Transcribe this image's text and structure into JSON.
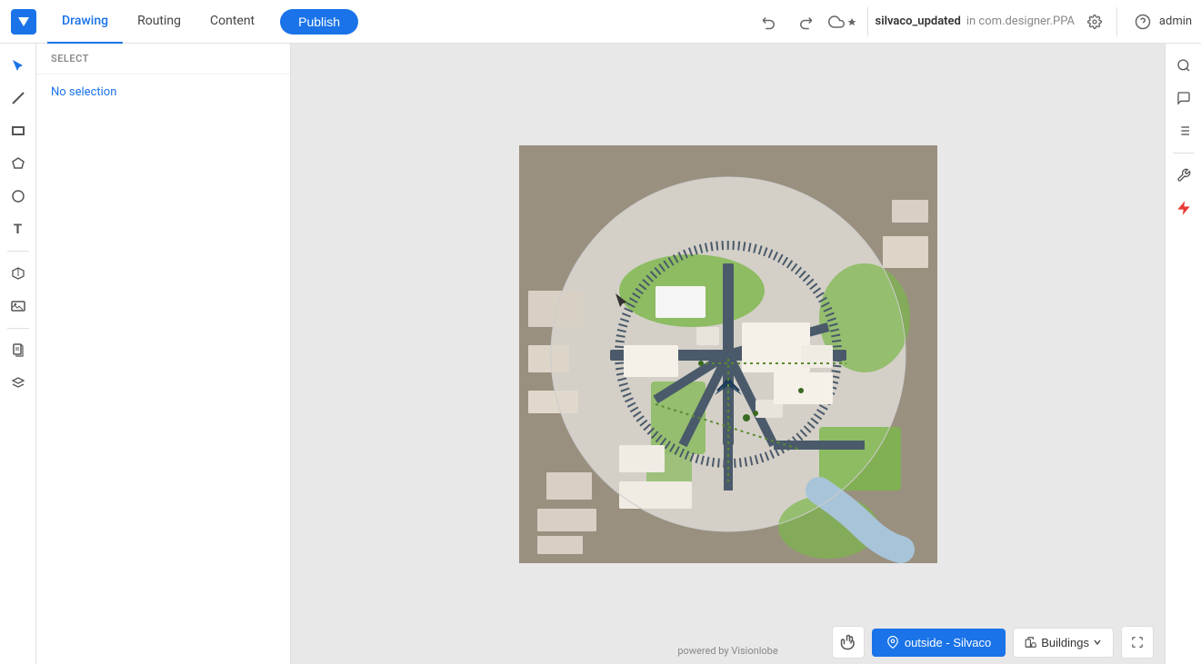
{
  "topbar": {
    "logo_label": "V",
    "tabs": [
      {
        "id": "drawing",
        "label": "Drawing",
        "active": true
      },
      {
        "id": "routing",
        "label": "Routing",
        "active": false
      },
      {
        "id": "content",
        "label": "Content",
        "active": false
      }
    ],
    "publish_label": "Publish",
    "undo_icon": "undo",
    "redo_icon": "redo",
    "cloud_icon": "cloud",
    "project_name": "silvaco_updated",
    "project_path": "in com.designer.PPA",
    "help_icon": "help",
    "user_label": "admin",
    "settings_icon": "settings"
  },
  "left_tools": {
    "tools": [
      {
        "id": "select",
        "icon": "✦",
        "label": "select-tool"
      },
      {
        "id": "line",
        "icon": "↗",
        "label": "line-tool"
      },
      {
        "id": "rectangle",
        "icon": "▭",
        "label": "rectangle-tool"
      },
      {
        "id": "polygon",
        "icon": "⬠",
        "label": "polygon-tool"
      },
      {
        "id": "circle",
        "icon": "○",
        "label": "circle-tool"
      },
      {
        "id": "text",
        "icon": "T",
        "label": "text-tool"
      },
      {
        "id": "box3d",
        "icon": "⬛",
        "label": "3d-box-tool"
      },
      {
        "id": "image",
        "icon": "🏔",
        "label": "image-tool"
      },
      {
        "id": "document",
        "icon": "📄",
        "label": "document-tool"
      },
      {
        "id": "layers",
        "icon": "⊞",
        "label": "layers-tool"
      }
    ]
  },
  "left_panel": {
    "header": "SELECT",
    "no_selection_text": "No selection"
  },
  "canvas": {
    "powered_by": "powered by Visionlobe"
  },
  "bottom_bar": {
    "hand_icon": "✋",
    "location_label": "outside - Silvaco",
    "buildings_label": "Buildings",
    "fullscreen_icon": "⛶"
  },
  "right_panel": {
    "tools": [
      {
        "id": "search",
        "icon": "search",
        "label": "search-panel-btn"
      },
      {
        "id": "comments",
        "icon": "chat",
        "label": "comments-panel-btn"
      },
      {
        "id": "list",
        "icon": "list",
        "label": "list-panel-btn"
      },
      {
        "id": "wrench",
        "icon": "wrench",
        "label": "settings-panel-btn",
        "separator_before": true
      },
      {
        "id": "lightning",
        "icon": "lightning",
        "label": "lightning-panel-btn",
        "red": true
      }
    ]
  }
}
